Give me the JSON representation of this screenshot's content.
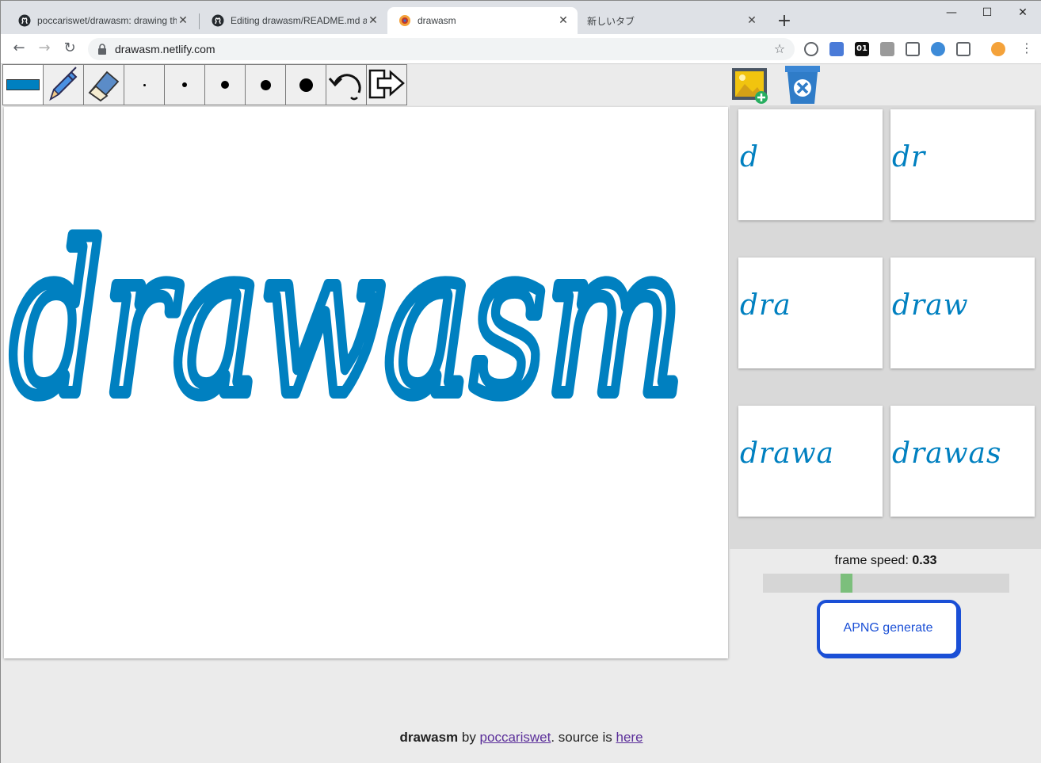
{
  "browser": {
    "tabs": [
      {
        "title": "poccariswet/drawasm: drawing th",
        "icon": "github-icon"
      },
      {
        "title": "Editing drawasm/README.md at",
        "icon": "github-icon"
      },
      {
        "title": "drawasm",
        "icon": "drawasm-favicon"
      },
      {
        "title": "新しいタブ",
        "icon": ""
      }
    ],
    "active_tab": 2,
    "new_tab_label": "+",
    "url": "drawasm.netlify.com",
    "controls": {
      "minimize": "—",
      "maximize": "☐",
      "close": "✕"
    },
    "nav": {
      "back": "←",
      "forward": "→",
      "reload": "↻"
    },
    "extensions": [
      "adblock-icon",
      "translate-icon",
      "01-icon",
      "message-icon",
      "pocket-icon",
      "check-icon",
      "shield-icon",
      "avatar"
    ],
    "ext_badge_01": "01"
  },
  "app": {
    "brush_color": "#0080c0",
    "tools": [
      "color-picker",
      "pen-tool",
      "eraser-tool",
      "size-1",
      "size-2",
      "size-3",
      "size-4",
      "size-5",
      "undo-tool",
      "export-tool"
    ],
    "canvas_text": "drawasm",
    "frames": [
      "d",
      "dr",
      "dra",
      "draw",
      "drawa",
      "drawas"
    ],
    "frame_speed_label": "frame speed:",
    "frame_speed_value": "0.33",
    "frame_speed_fraction": 0.33,
    "apng_button": "APNG generate",
    "footer": {
      "name": "drawasm",
      "by": " by ",
      "author": "poccariswet",
      "source_text": ". source is ",
      "source_link": "here"
    }
  }
}
